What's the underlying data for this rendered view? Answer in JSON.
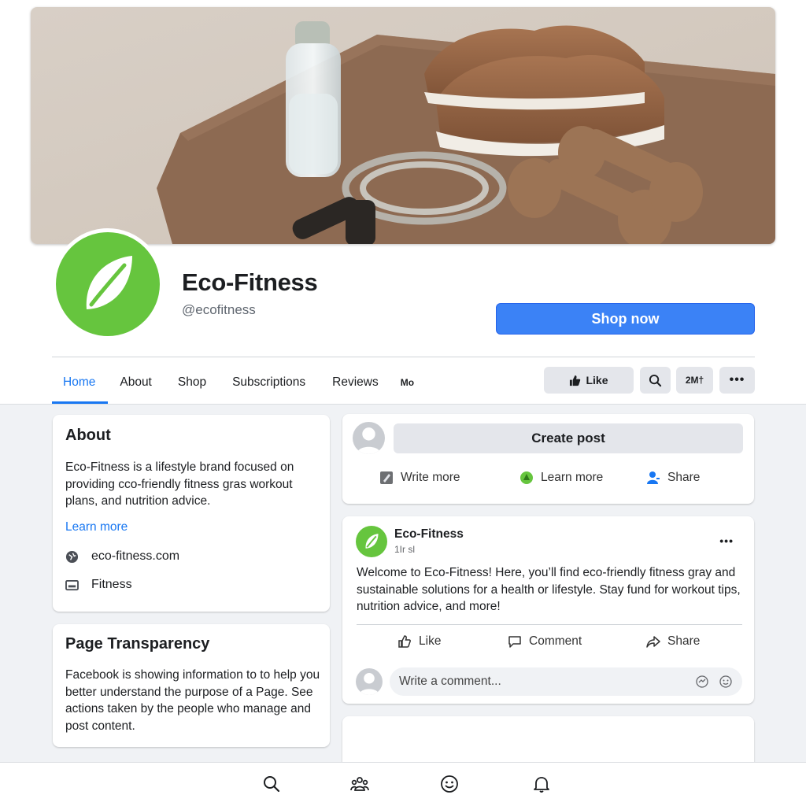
{
  "page": {
    "name": "Eco-Fitness",
    "handle": "@ecofitness",
    "brand_color": "#66c53e",
    "accent_color": "#1877f2"
  },
  "cover": {
    "icon": "cover-photo"
  },
  "cta": {
    "label": "Shop now"
  },
  "tabs": [
    {
      "label": "Home",
      "active": true
    },
    {
      "label": "About"
    },
    {
      "label": "Shop"
    },
    {
      "label": "Subscriptions"
    },
    {
      "label": "Reviews"
    },
    {
      "label": "Mo"
    }
  ],
  "actions": {
    "like_label": "Like",
    "badge_label": "2М†"
  },
  "about": {
    "title": "About",
    "description": "Eco-Fitness is a lifestyle brand focused on providing cco-friendly fitness gras workout plans, and nutrition advice.",
    "learn_more": "Learn more",
    "website": "eco-fitness.com",
    "category": "Fitness"
  },
  "transparency": {
    "title": "Page Transparency",
    "description": "Facebook is showing information to to help you better understand the purpose of a Page. See actions taken by the people who manage and post content."
  },
  "create_post": {
    "button_label": "Create post",
    "actions": [
      {
        "label": "Write more",
        "icon": "edit-icon"
      },
      {
        "label": "Learn more",
        "icon": "leaf-icon"
      },
      {
        "label": "Share",
        "icon": "person-icon"
      }
    ]
  },
  "post": {
    "author": "Eco-Fitness",
    "time": "1Іr sl",
    "body": "Welcome to Eco-Fitness! Here, you’ll find eco-friendly fitness gray and sustainable solutions for a health or lifestyle. Stay fund for workout tips, nutrition advice, and more!",
    "like_label": "Like",
    "comment_label": "Comment",
    "share_label": "Share",
    "comment_placeholder": "Write a comment..."
  },
  "bottom_nav": [
    {
      "icon": "search-icon"
    },
    {
      "icon": "groups-icon"
    },
    {
      "icon": "emoji-icon"
    },
    {
      "icon": "bell-icon"
    }
  ]
}
